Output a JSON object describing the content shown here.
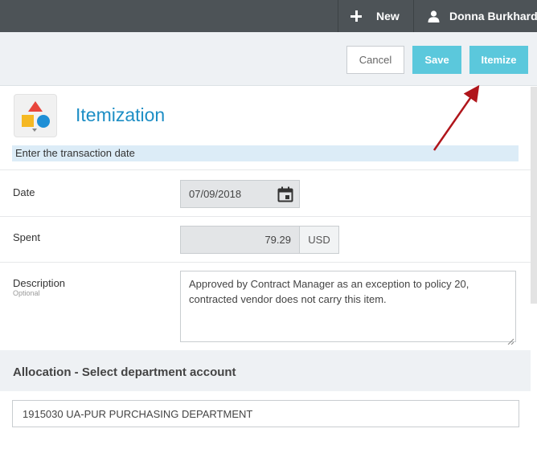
{
  "topbar": {
    "new_label": "New",
    "user_name": "Donna Burkhardt"
  },
  "actions": {
    "cancel_label": "Cancel",
    "save_label": "Save",
    "itemize_label": "Itemize"
  },
  "page": {
    "title": "Itemization",
    "hint": "Enter the transaction date"
  },
  "form": {
    "date_label": "Date",
    "date_value": "07/09/2018",
    "spent_label": "Spent",
    "spent_value": "79.29",
    "currency": "USD",
    "description_label": "Description",
    "description_sublabel": "Optional",
    "description_value": "Approved by Contract Manager as an exception to policy 20, contracted vendor does not carry this item."
  },
  "allocation": {
    "title": "Allocation - Select department account",
    "department_value": "1915030 UA-PUR PURCHASING DEPARTMENT"
  },
  "colors": {
    "accent": "#5bc8dc",
    "title_blue": "#1d8ec5",
    "annotation_arrow": "#b0151b"
  },
  "icons": {
    "new": "plus-icon",
    "user": "user-icon",
    "calendar": "calendar-icon",
    "app": "shapes-icon"
  }
}
